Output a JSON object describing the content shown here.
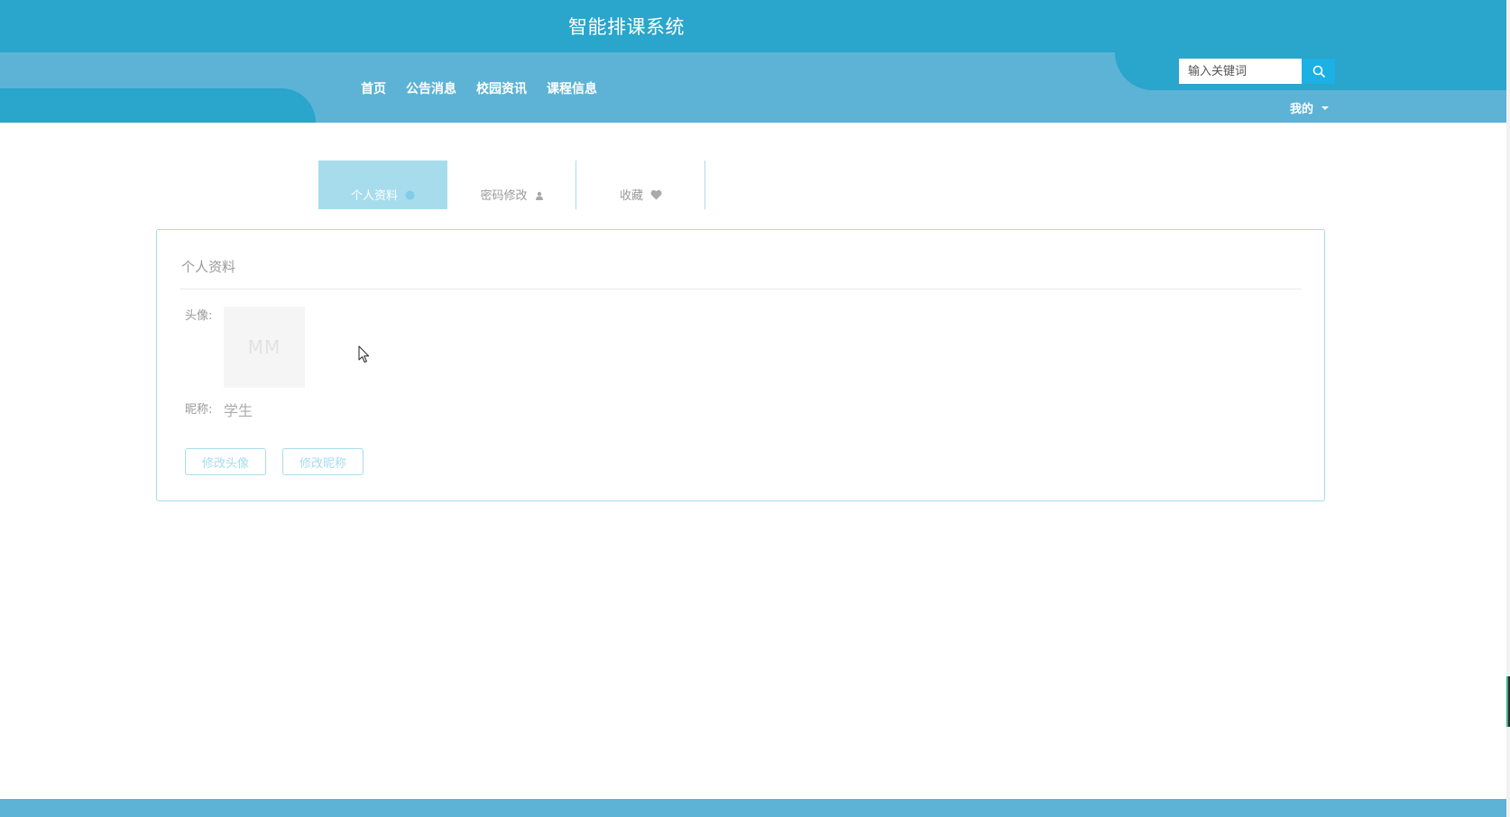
{
  "header": {
    "title": "智能排课系统",
    "nav": [
      "首页",
      "公告消息",
      "校园资讯",
      "课程信息"
    ],
    "search": {
      "placeholder": "输入关键词",
      "icon": "search-icon"
    },
    "user_menu": "我的"
  },
  "tabs": [
    {
      "label": "个人资料",
      "icon": "info-icon",
      "active": true
    },
    {
      "label": "密码修改",
      "icon": "user-icon",
      "active": false
    },
    {
      "label": "收藏",
      "icon": "heart-icon",
      "active": false
    }
  ],
  "profile": {
    "title": "个人资料",
    "avatar_label": "头像:",
    "avatar_placeholder": "MM",
    "nickname_label": "昵称:",
    "nickname_value": "学生",
    "change_avatar_button": "修改头像",
    "change_nickname_button": "修改昵称"
  },
  "colors": {
    "primary": "#2aa5cb",
    "secondary": "#5cb3d6",
    "accent_light": "#a7dced",
    "search_button": "#1cb0e4"
  }
}
